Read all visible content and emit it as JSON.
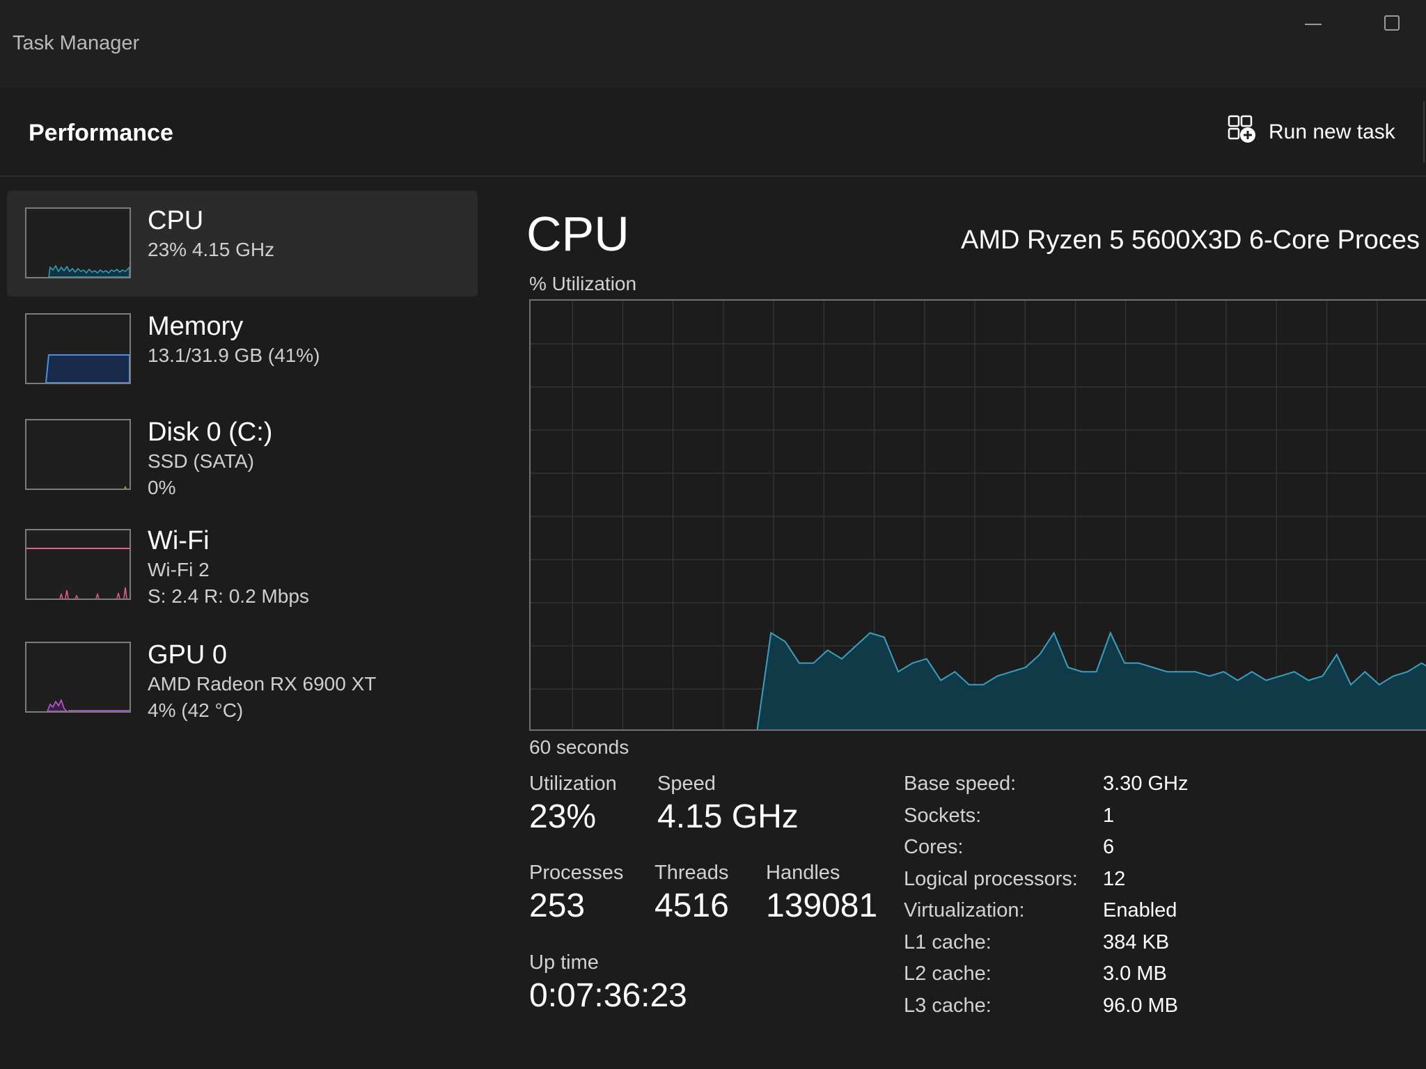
{
  "window": {
    "title": "Task Manager"
  },
  "header": {
    "title": "Performance",
    "run_new_task": "Run new task"
  },
  "sidebar": {
    "items": [
      {
        "name": "CPU",
        "sub": "23%  4.15 GHz",
        "color": "#3ba0c0"
      },
      {
        "name": "Memory",
        "sub": "13.1/31.9 GB (41%)",
        "color": "#4a8fe8"
      },
      {
        "name": "Disk 0 (C:)",
        "sub1": "SSD (SATA)",
        "sub2": "0%",
        "color": "#78b140"
      },
      {
        "name": "Wi-Fi",
        "sub1": "Wi-Fi 2",
        "sub2": "S: 2.4  R: 0.2 Mbps",
        "color": "#e0608f"
      },
      {
        "name": "GPU 0",
        "sub1": "AMD Radeon RX 6900 XT",
        "sub2": "4%  (42 °C)",
        "color": "#c060d8"
      }
    ]
  },
  "main": {
    "title": "CPU",
    "processor": "AMD Ryzen 5 5600X3D 6-Core Proces",
    "util_label": "% Utilization",
    "seconds_label": "60 seconds",
    "stats": {
      "utilization": {
        "label": "Utilization",
        "value": "23%"
      },
      "speed": {
        "label": "Speed",
        "value": "4.15 GHz"
      },
      "processes": {
        "label": "Processes",
        "value": "253"
      },
      "threads": {
        "label": "Threads",
        "value": "4516"
      },
      "handles": {
        "label": "Handles",
        "value": "139081"
      },
      "uptime": {
        "label": "Up time",
        "value": "0:07:36:23"
      }
    },
    "specs": [
      {
        "key": "Base speed:",
        "value": "3.30 GHz"
      },
      {
        "key": "Sockets:",
        "value": "1"
      },
      {
        "key": "Cores:",
        "value": "6"
      },
      {
        "key": "Logical processors:",
        "value": "12"
      },
      {
        "key": "Virtualization:",
        "value": "Enabled"
      },
      {
        "key": "L1 cache:",
        "value": "384 KB"
      },
      {
        "key": "L2 cache:",
        "value": "3.0 MB"
      },
      {
        "key": "L3 cache:",
        "value": "96.0 MB"
      }
    ]
  },
  "chart_data": {
    "type": "area",
    "x_range": [
      60,
      0
    ],
    "ylim": [
      0,
      100
    ],
    "grid": true,
    "color": "#3ba0c0",
    "values": [
      0,
      0,
      0,
      0,
      0,
      0,
      0,
      0,
      0,
      0,
      0,
      0,
      0,
      0,
      0,
      0,
      0,
      23,
      21,
      16,
      16,
      19,
      17,
      20,
      23,
      22,
      14,
      16,
      17,
      12,
      14,
      11,
      11,
      13,
      14,
      15,
      18,
      23,
      15,
      14,
      14,
      23,
      16,
      16,
      15,
      14,
      14,
      14,
      13,
      14,
      12,
      14,
      12,
      13,
      14,
      12,
      13,
      18,
      11,
      14,
      11,
      13,
      14,
      16,
      14
    ]
  }
}
